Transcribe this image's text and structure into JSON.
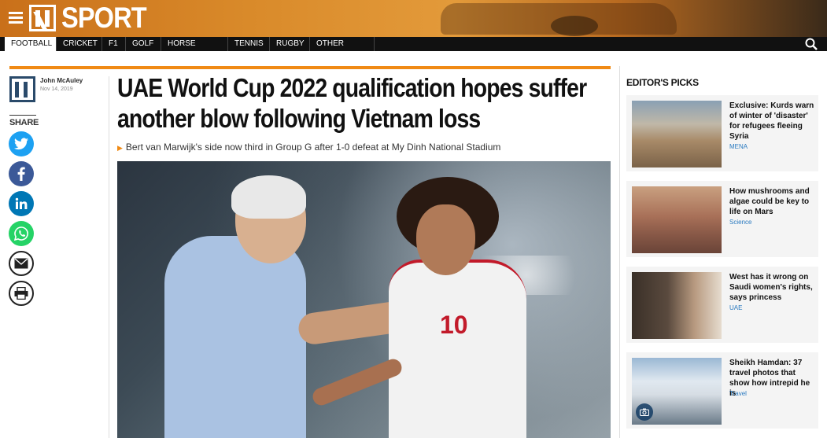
{
  "header": {
    "section_title": "SPORT"
  },
  "nav": {
    "items": [
      {
        "label": "FOOTBALL",
        "active": true
      },
      {
        "label": "CRICKET"
      },
      {
        "label": "F1"
      },
      {
        "label": "GOLF"
      },
      {
        "label": "HORSE RACING"
      },
      {
        "label": "TENNIS"
      },
      {
        "label": "RUGBY"
      },
      {
        "label": "OTHER SPORT"
      }
    ]
  },
  "article": {
    "author": "John McAuley",
    "date": "Nov 14, 2019",
    "share_label": "SHARE",
    "headline_line1": "UAE World Cup 2022 qualification hopes suffer",
    "headline_line2": "another blow following Vietnam loss",
    "standfirst": "Bert van Marwijk's side now third in Group G after 1-0 defeat at My Dinh National Stadium",
    "hero": {
      "jersey_number": "10"
    }
  },
  "share_buttons": [
    {
      "name": "twitter-icon",
      "color": "#1da1f2"
    },
    {
      "name": "facebook-icon",
      "color": "#3b5998"
    },
    {
      "name": "linkedin-icon",
      "color": "#0077b5"
    },
    {
      "name": "whatsapp-icon",
      "color": "#25d366"
    },
    {
      "name": "email-icon",
      "color": "#ffffff"
    },
    {
      "name": "print-icon",
      "color": "#ffffff"
    }
  ],
  "editors_picks": {
    "title": "EDITOR'S PICKS",
    "items": [
      {
        "title": "Exclusive: Kurds warn of winter of 'disaster' for refugees fleeing Syria",
        "category": "MENA"
      },
      {
        "title": "How mushrooms and algae could be key to life on Mars",
        "category": "Science"
      },
      {
        "title": "West has it wrong on Saudi women's rights, says princess",
        "category": "UAE"
      },
      {
        "title": "Sheikh Hamdan: 37 travel photos that show how intrepid he is",
        "category": "Travel"
      }
    ]
  },
  "colors": {
    "accent": "#f08a14",
    "nav_bg": "#111111",
    "link": "#2a7ac0",
    "jersey_red": "#c21a2a"
  }
}
